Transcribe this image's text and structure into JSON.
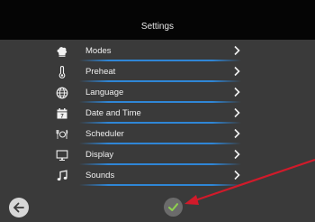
{
  "header": {
    "title": "Settings"
  },
  "menu": {
    "items": [
      {
        "label": "Modes",
        "icon": "chef-hat-icon"
      },
      {
        "label": "Preheat",
        "icon": "thermometer-icon"
      },
      {
        "label": "Language",
        "icon": "globe-icon"
      },
      {
        "label": "Date and Time",
        "icon": "calendar-icon"
      },
      {
        "label": "Scheduler",
        "icon": "scheduler-icon"
      },
      {
        "label": "Display",
        "icon": "monitor-icon"
      },
      {
        "label": "Sounds",
        "icon": "music-note-icon"
      }
    ]
  },
  "footer": {
    "back_icon": "arrow-left-icon",
    "confirm_icon": "checkmark-icon"
  },
  "colors": {
    "background": "#3a3a3a",
    "header": "#050505",
    "separator": "#2f86d6",
    "confirm_check": "#8fd14f",
    "annotation_arrow": "#d11a2a"
  }
}
